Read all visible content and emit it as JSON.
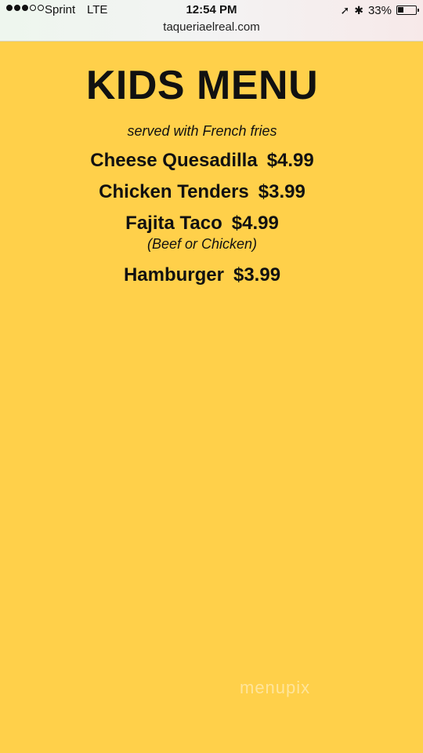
{
  "status_bar": {
    "carrier": "Sprint",
    "network": "LTE",
    "time": "12:54 PM",
    "battery_percent": "33%",
    "battery_level": 0.33,
    "signal_bars_filled": 3,
    "signal_bars_total": 5,
    "icons": [
      "location-arrow-icon",
      "bluetooth-icon",
      "battery-icon"
    ]
  },
  "browser": {
    "url": "taqueriaelreal.com"
  },
  "menu": {
    "title": "KIDS MENU",
    "subtitle": "served with French fries",
    "items": [
      {
        "name": "Cheese Quesadilla",
        "price": "$4.99",
        "note": ""
      },
      {
        "name": "Chicken Tenders",
        "price": "$3.99",
        "note": ""
      },
      {
        "name": "Fajita Taco",
        "price": "$4.99",
        "note": "(Beef or Chicken)"
      },
      {
        "name": "Hamburger",
        "price": "$3.99",
        "note": ""
      }
    ]
  },
  "watermark": "menupix",
  "colors": {
    "background": "#ffd04a",
    "text": "#111111"
  }
}
